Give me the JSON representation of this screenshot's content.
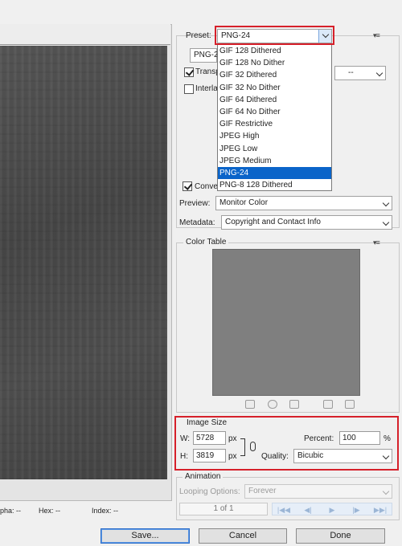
{
  "preview": {
    "status": {
      "alpha": "pha: --",
      "hex": "Hex: --",
      "index": "Index: --"
    }
  },
  "preset": {
    "label": "Preset:",
    "value": "PNG-24",
    "options": [
      "GIF 128 Dithered",
      "GIF 128 No Dither",
      "GIF 32 Dithered",
      "GIF 32 No Dither",
      "GIF 64 Dithered",
      "GIF 64 No Dither",
      "GIF Restrictive",
      "JPEG High",
      "JPEG Low",
      "JPEG Medium",
      "PNG-24",
      "PNG-8 128 Dithered"
    ],
    "selected_index": 10
  },
  "format_partial": "PNG-2",
  "transparency_partial": "Transp",
  "interlaced_partial": "Interla",
  "matte_value": "--",
  "convert_partial": "Conve",
  "preview_setting": {
    "label": "Preview:",
    "value": "Monitor Color"
  },
  "metadata": {
    "label": "Metadata:",
    "value": "Copyright and Contact Info"
  },
  "color_table": {
    "title": "Color Table"
  },
  "image_size": {
    "title": "Image Size",
    "w_label": "W:",
    "w_value": "5728",
    "w_unit": "px",
    "h_label": "H:",
    "h_value": "3819",
    "h_unit": "px",
    "percent_label": "Percent:",
    "percent_value": "100",
    "percent_unit": "%",
    "quality_label": "Quality:",
    "quality_value": "Bicubic"
  },
  "animation": {
    "title": "Animation",
    "looping_label": "Looping Options:",
    "looping_value": "Forever",
    "frame_counter": "1 of 1"
  },
  "buttons": {
    "save": "Save...",
    "cancel": "Cancel",
    "done": "Done"
  },
  "colors": {
    "highlight": "#0a64c9",
    "annotation": "#d6202a"
  }
}
